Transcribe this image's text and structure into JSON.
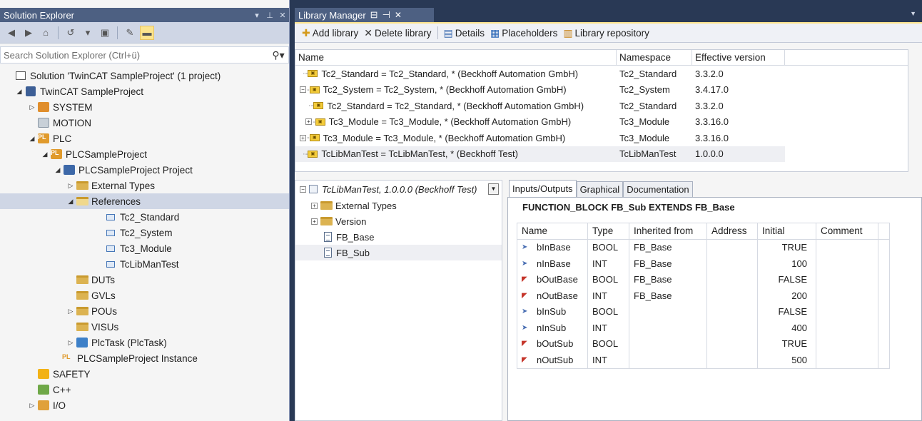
{
  "solution_explorer": {
    "title": "Solution Explorer",
    "title_buttons": [
      "▾",
      "⊥",
      "✕"
    ],
    "search_placeholder": "Search Solution Explorer (Ctrl+ü)",
    "tree": [
      {
        "label": "Solution 'TwinCAT SampleProject' (1 project)",
        "icon": "solution-icon"
      },
      {
        "label": "TwinCAT SampleProject",
        "icon": "twincat-project-icon"
      },
      {
        "label": "SYSTEM",
        "icon": "system-icon"
      },
      {
        "label": "MOTION",
        "icon": "motion-icon"
      },
      {
        "label": "PLC",
        "icon": "plc-icon"
      },
      {
        "label": "PLCSampleProject",
        "icon": "plc-project-icon"
      },
      {
        "label": "PLCSampleProject Project",
        "icon": "plc-subproject-icon"
      },
      {
        "label": "External Types",
        "icon": "folder-icon"
      },
      {
        "label": "References",
        "icon": "folder-open-icon"
      },
      {
        "label": "Tc2_Standard",
        "icon": "reference-icon"
      },
      {
        "label": "Tc2_System",
        "icon": "reference-icon"
      },
      {
        "label": "Tc3_Module",
        "icon": "reference-icon"
      },
      {
        "label": "TcLibManTest",
        "icon": "reference-icon"
      },
      {
        "label": "DUTs",
        "icon": "folder-icon"
      },
      {
        "label": "GVLs",
        "icon": "folder-icon"
      },
      {
        "label": "POUs",
        "icon": "folder-icon"
      },
      {
        "label": "VISUs",
        "icon": "folder-icon"
      },
      {
        "label": "PlcTask (PlcTask)",
        "icon": "task-icon"
      },
      {
        "label": "PLCSampleProject Instance",
        "icon": "plc-instance-icon"
      },
      {
        "label": "SAFETY",
        "icon": "safety-icon"
      },
      {
        "label": "C++",
        "icon": "cpp-icon"
      },
      {
        "label": "I/O",
        "icon": "io-icon"
      }
    ]
  },
  "library_manager": {
    "tab_title": "Library Manager",
    "toolbar": {
      "add_label": "Add library",
      "delete_label": "Delete library",
      "details_label": "Details",
      "placeholders_label": "Placeholders",
      "repository_label": "Library repository"
    },
    "columns": [
      "Name",
      "Namespace",
      "Effective version"
    ],
    "libraries": [
      {
        "name": "Tc2_Standard = Tc2_Standard, * (Beckhoff Automation GmbH)",
        "namespace": "Tc2_Standard",
        "version": "3.3.2.0"
      },
      {
        "name": "Tc2_System = Tc2_System, * (Beckhoff Automation GmbH)",
        "namespace": "Tc2_System",
        "version": "3.4.17.0"
      },
      {
        "name": "Tc2_Standard = Tc2_Standard, * (Beckhoff Automation GmbH)",
        "namespace": "Tc2_Standard",
        "version": "3.3.2.0"
      },
      {
        "name": "Tc3_Module = Tc3_Module, * (Beckhoff Automation GmbH)",
        "namespace": "Tc3_Module",
        "version": "3.3.16.0"
      },
      {
        "name": "Tc3_Module = Tc3_Module, * (Beckhoff Automation GmbH)",
        "namespace": "Tc3_Module",
        "version": "3.3.16.0"
      },
      {
        "name": "TcLibManTest = TcLibManTest, * (Beckhoff Test)",
        "namespace": "TcLibManTest",
        "version": "1.0.0.0"
      }
    ],
    "lib_tree": {
      "root_label": "TcLibManTest, 1.0.0.0 (Beckhoff Test)",
      "items": [
        "External Types",
        "Version",
        "FB_Base",
        "FB_Sub"
      ]
    },
    "detail_tabs": [
      "Inputs/Outputs",
      "Graphical",
      "Documentation"
    ],
    "fb_declaration": "FUNCTION_BLOCK FB_Sub EXTENDS FB_Base",
    "io_columns": [
      "Name",
      "Type",
      "Inherited from",
      "Address",
      "Initial",
      "Comment"
    ],
    "io_rows": [
      {
        "name": "bInBase",
        "type": "BOOL",
        "inherited": "FB_Base",
        "address": "",
        "initial": "TRUE",
        "comment": "",
        "dir": "in"
      },
      {
        "name": "nInBase",
        "type": "INT",
        "inherited": "FB_Base",
        "address": "",
        "initial": "100",
        "comment": "",
        "dir": "in"
      },
      {
        "name": "bOutBase",
        "type": "BOOL",
        "inherited": "FB_Base",
        "address": "",
        "initial": "FALSE",
        "comment": "",
        "dir": "out"
      },
      {
        "name": "nOutBase",
        "type": "INT",
        "inherited": "FB_Base",
        "address": "",
        "initial": "200",
        "comment": "",
        "dir": "out"
      },
      {
        "name": "bInSub",
        "type": "BOOL",
        "inherited": "",
        "address": "",
        "initial": "FALSE",
        "comment": "",
        "dir": "in"
      },
      {
        "name": "nInSub",
        "type": "INT",
        "inherited": "",
        "address": "",
        "initial": "400",
        "comment": "",
        "dir": "in"
      },
      {
        "name": "bOutSub",
        "type": "BOOL",
        "inherited": "",
        "address": "",
        "initial": "TRUE",
        "comment": "",
        "dir": "out"
      },
      {
        "name": "nOutSub",
        "type": "INT",
        "inherited": "",
        "address": "",
        "initial": "500",
        "comment": "",
        "dir": "out"
      }
    ]
  },
  "colors": {
    "frame": "#293955",
    "title_bar": "#4d6082",
    "toolbar_highlight": "#fce48d"
  }
}
